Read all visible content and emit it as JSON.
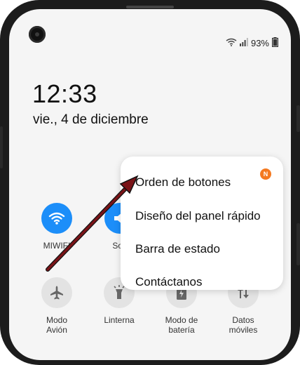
{
  "status_bar": {
    "battery": "93%",
    "icons": [
      "wifi-calling-icon",
      "signal-icon",
      "battery-icon"
    ]
  },
  "lock": {
    "time": "12:33",
    "date": "vie., 4 de diciembre"
  },
  "quick_tiles": [
    {
      "label": "MIWIFI",
      "icon": "wifi-icon",
      "active": true
    },
    {
      "label": "Son",
      "icon": "sound-icon",
      "active": true
    },
    {
      "label": "Modo\nAvión",
      "icon": "airplane-icon",
      "active": false
    },
    {
      "label": "Linterna",
      "icon": "flashlight-icon",
      "active": false
    },
    {
      "label": "Modo de\nbatería",
      "icon": "battery-mode-icon",
      "active": false
    },
    {
      "label": "Datos\nmóviles",
      "icon": "mobile-data-icon",
      "active": false
    }
  ],
  "menu": {
    "items": [
      {
        "label": "Orden de botones",
        "badge": "N"
      },
      {
        "label": "Diseño del panel rápido"
      },
      {
        "label": "Barra de estado"
      },
      {
        "label": "Contáctanos"
      }
    ]
  },
  "colors": {
    "accent": "#1c8ef9",
    "badge": "#f47920",
    "arrow": "#7a1418"
  }
}
